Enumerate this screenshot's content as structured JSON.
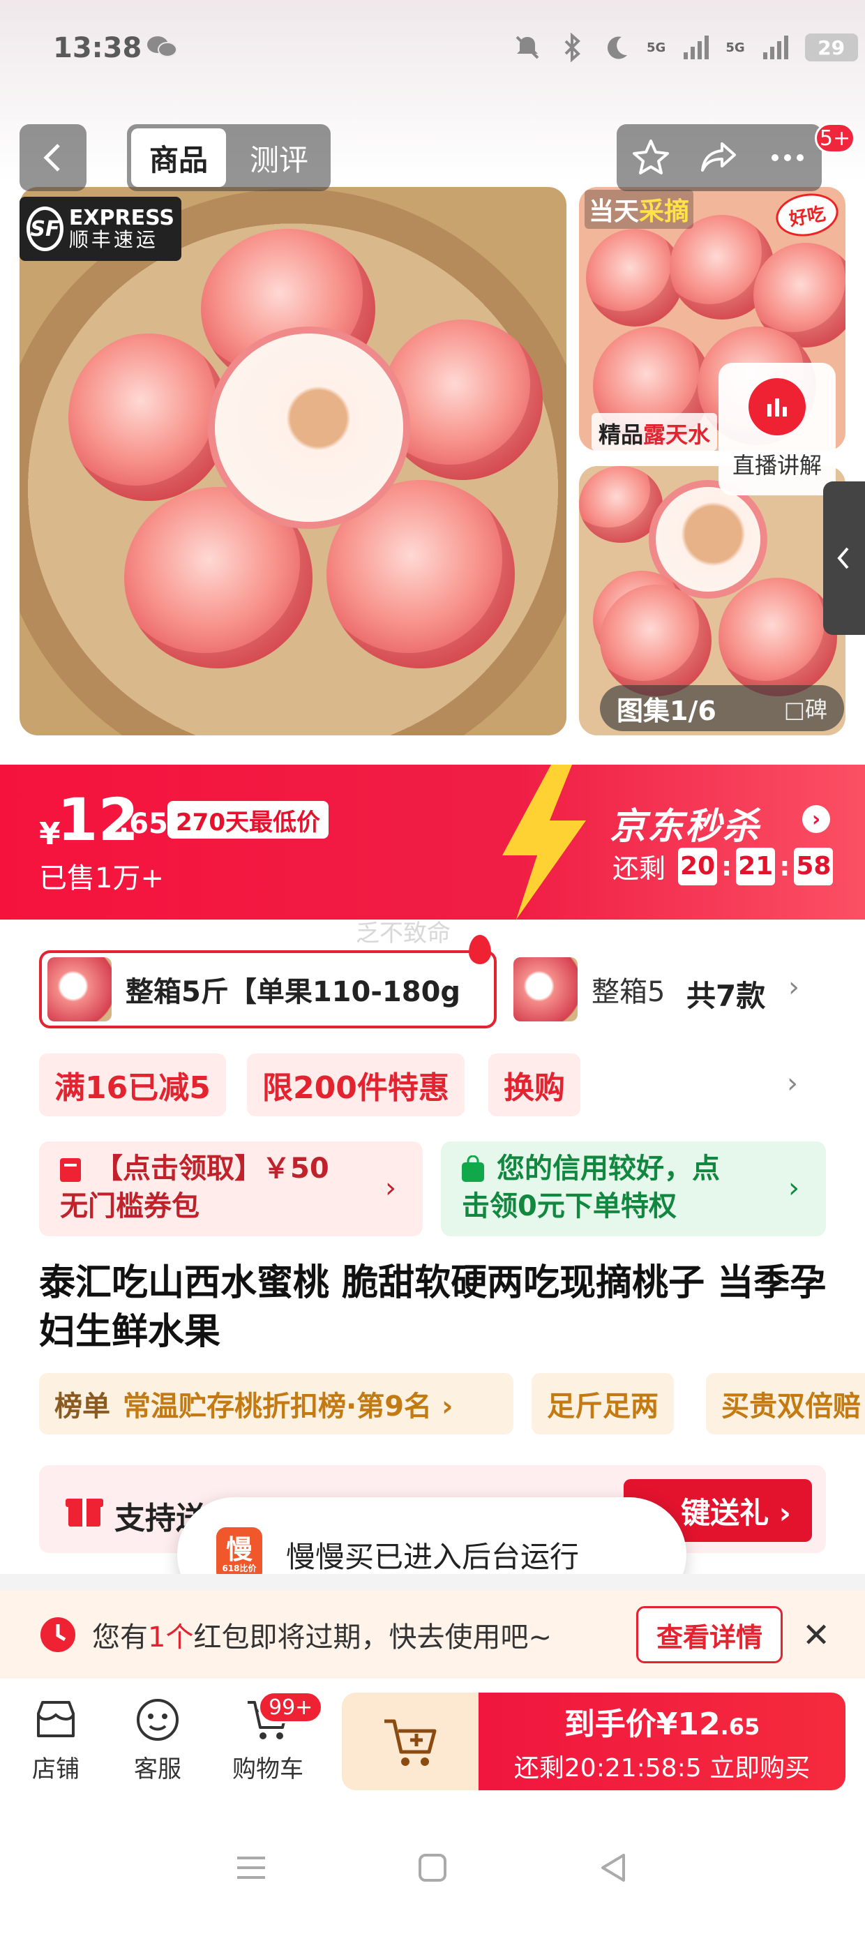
{
  "status_bar": {
    "time": "13:38",
    "net1": "5G",
    "net2": "5G",
    "battery": "29",
    "icons": [
      "wechat-icon",
      "mute-icon",
      "bluetooth-icon",
      "moon-icon",
      "signal-icon",
      "signal-icon"
    ]
  },
  "nav": {
    "tabs": [
      {
        "label": "商品",
        "active": true
      },
      {
        "label": "测评",
        "active": false
      }
    ],
    "badge": "5+",
    "icons": [
      "back-icon",
      "star-icon",
      "share-icon",
      "more-icon"
    ]
  },
  "gallery": {
    "main_logo_line1": "EXPRESS",
    "main_logo_line2": "顺丰速运",
    "main_logo_mark": "SF",
    "thumb1_tag_prefix": "当天",
    "thumb1_tag_highlight": "采摘",
    "thumb1_stamp": "好吃",
    "thumb1_caption_prefix": "精品",
    "thumb1_caption_highlight": "露天水",
    "live_label": "直播讲解",
    "counter": "图集1/6",
    "brand_label": "□碑"
  },
  "price": {
    "currency": "¥",
    "integer": "12",
    "decimal": ".65",
    "badge": "270天最低价",
    "sold": "已售1万+"
  },
  "seckill": {
    "title": "京东秒杀",
    "remaining_label": "还剩",
    "hours": "20",
    "minutes": "21",
    "seconds": "58"
  },
  "watermark": "乏不致命",
  "variants": {
    "selected": "整箱5斤【单果110-180g",
    "other": "整箱5",
    "count": "共7款"
  },
  "promos": [
    {
      "label": "满16已减5"
    },
    {
      "label": "限200件特惠"
    },
    {
      "label": "换购"
    }
  ],
  "coupons": {
    "red_line1": "【点击领取】￥50",
    "red_line2": "无门槛券包",
    "green_line1": "您的信用较好，点",
    "green_line2": "击领0元下单特权"
  },
  "product_title": "泰汇吃山西水蜜桃 脆甜软硬两吃现摘桃子 当季孕妇生鲜水果",
  "rank": {
    "key": "榜单",
    "value": "常温贮存桃折扣榜·第9名 ›"
  },
  "tags": [
    {
      "label": "足斤足两"
    },
    {
      "label": "买贵双倍赔"
    }
  ],
  "gift": {
    "label": "支持送",
    "button": "键送礼 ›"
  },
  "toast": {
    "logo_char": "慢",
    "logo_sub": "618比价",
    "text": "慢慢买已进入后台运行"
  },
  "notice": {
    "prefix": "您有",
    "count": "1个",
    "suffix": "红包即将过期，快去使用吧~",
    "button": "查看详情"
  },
  "bottom": {
    "store": "店铺",
    "service": "客服",
    "cart": "购物车",
    "cart_badge": "99+",
    "buy_prefix": "到手价¥",
    "buy_int": "12",
    "buy_dec": ".65",
    "buy_sub": "还剩20:21:58:5  立即购买"
  },
  "colors": {
    "accent": "#f0163f",
    "price_band": "#f5133d",
    "green": "#11873f",
    "gold": "#c47a12"
  }
}
